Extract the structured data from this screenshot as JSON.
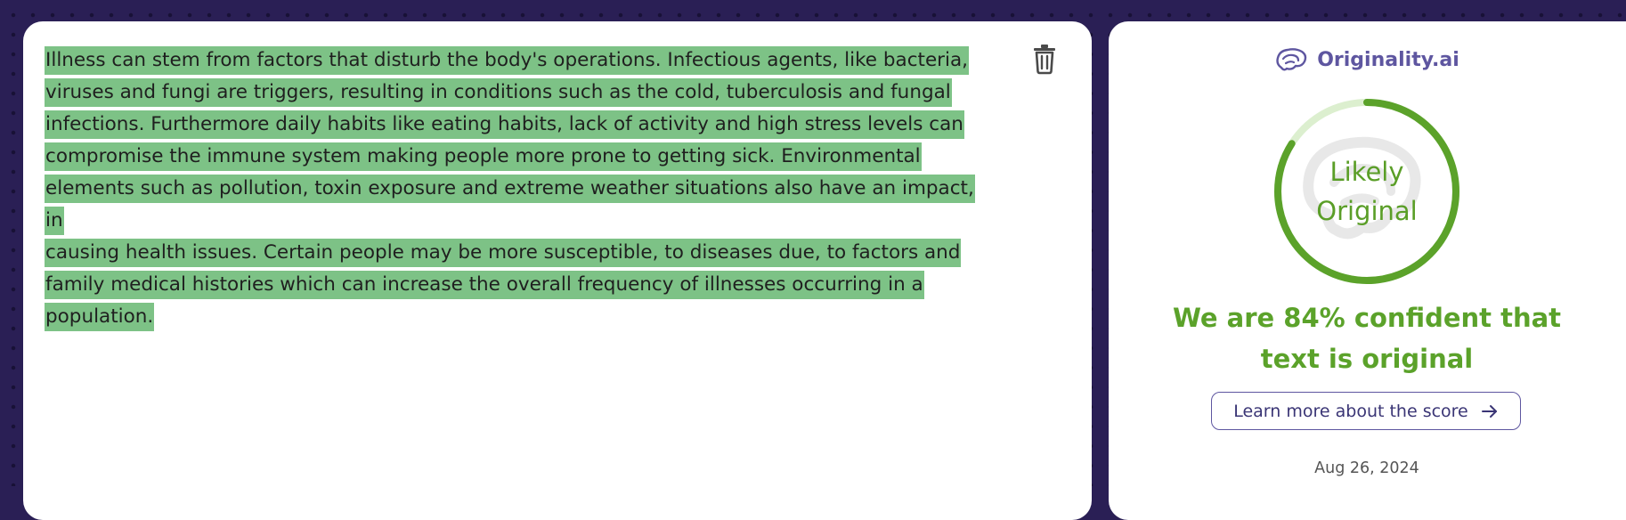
{
  "editor": {
    "lines": [
      "Illness can stem from factors that disturb the body's operations. Infectious agents, like bacteria,",
      "viruses and fungi are triggers, resulting in conditions such as the cold, tuberculosis and fungal",
      "infections. Furthermore daily habits like eating habits, lack of activity and high stress levels can",
      "compromise the immune system making people more prone to getting sick. Environmental",
      "elements such as pollution, toxin exposure and extreme weather situations also have an impact, in",
      "causing health issues. Certain people may be more susceptible, to diseases due, to factors and",
      "family medical histories which can increase the overall frequency of illnesses occurring in a",
      "population."
    ],
    "highlight_color": "#7dc286",
    "delete_icon": "trash-icon"
  },
  "result": {
    "brand_name": "Originality.ai",
    "brand_icon": "brain-icon",
    "gauge_label_line1": "Likely",
    "gauge_label_line2": "Original",
    "gauge_value": 0.84,
    "gauge_color": "#5ba22a",
    "gauge_track_color": "#dcefcf",
    "confidence_text": "We are 84% confident that text is original",
    "learn_more_label": "Learn more about the score",
    "learn_more_icon": "arrow-right-icon",
    "date": "Aug 26, 2024"
  }
}
